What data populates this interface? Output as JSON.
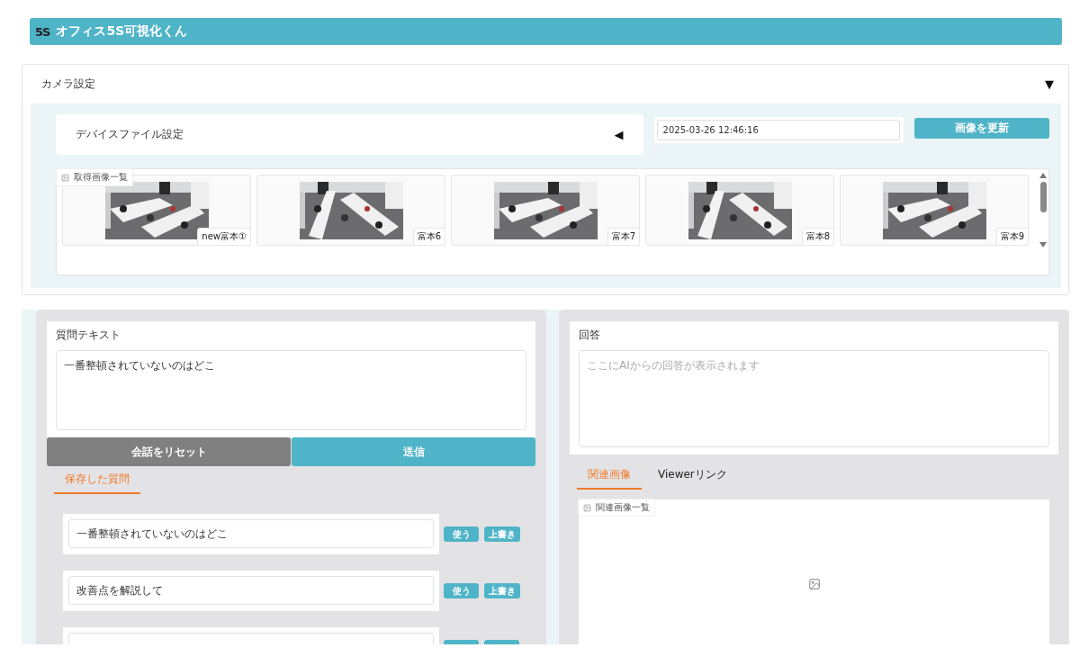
{
  "header": {
    "logo": "5S",
    "title": "オフィス5S可視化くん"
  },
  "camera": {
    "title": "カメラ設定",
    "toggle": "▼",
    "device": {
      "label": "デバイスファイル設定",
      "toggle": "◀"
    },
    "timestamp": "2025-03-26 12:46:16",
    "refresh_button": "画像を更新",
    "gallery": {
      "label": "取得画像一覧",
      "images": [
        {
          "kind": "picture",
          "caption": "new富本①"
        },
        {
          "kind": "picture",
          "caption": "富本6"
        },
        {
          "kind": "picture",
          "caption": "富本7"
        },
        {
          "kind": "picture",
          "caption": "富本8"
        },
        {
          "kind": "picture",
          "caption": "富本9"
        }
      ]
    }
  },
  "question": {
    "label": "質問テキスト",
    "value": "一番整頓されていないのはどこ",
    "reset_button": "会話をリセット",
    "send_button": "送信",
    "tabs": [
      {
        "label": "保存した質問",
        "selected": true
      }
    ],
    "saved": [
      {
        "kind": "full",
        "value": "一番整頓されていないのはどこ",
        "actions": [
          "使う",
          "上書き"
        ]
      },
      {
        "kind": "full",
        "value": "改善点を解説して",
        "actions": [
          "使う",
          "上書き"
        ]
      },
      {
        "kind": "cut"
      }
    ]
  },
  "answer": {
    "label": "回答",
    "placeholder": "ここにAIからの回答が表示されます",
    "tabs": [
      {
        "label": "関連画像",
        "selected": true
      },
      {
        "label": "Viewerリンク",
        "selected": false
      }
    ],
    "gallery": {
      "label": "関連画像一覧"
    }
  }
}
